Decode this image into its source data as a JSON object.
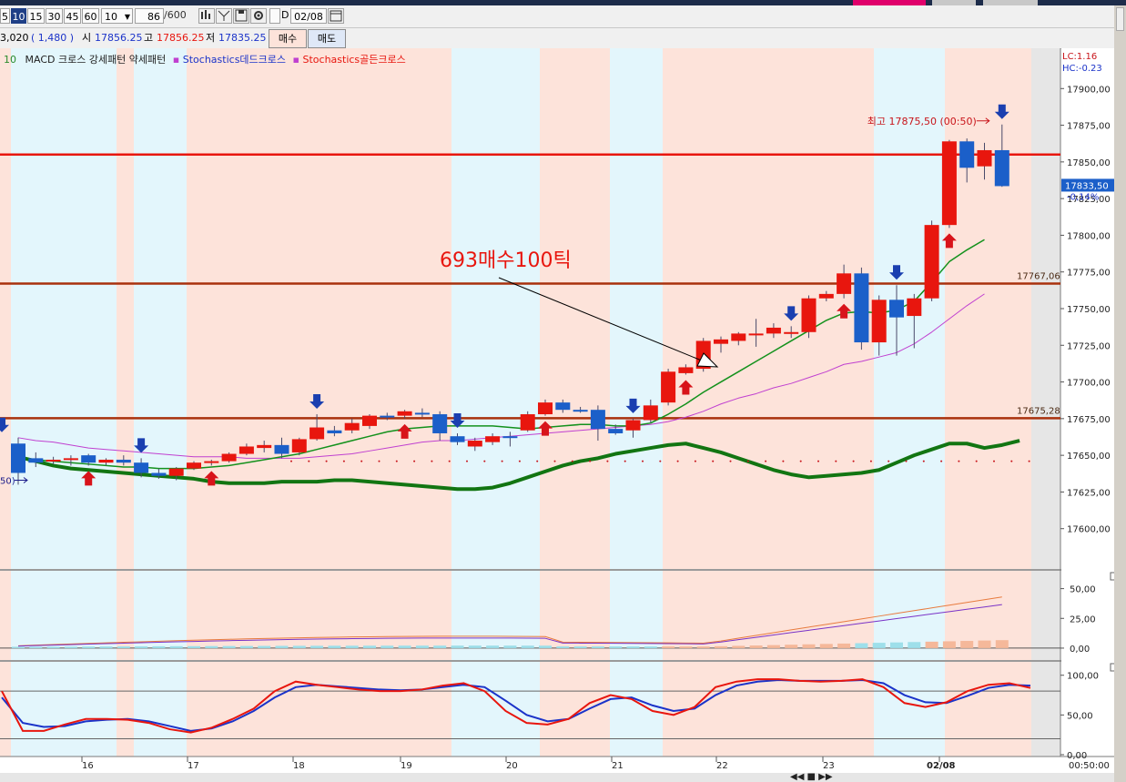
{
  "toolbar": {
    "periods": [
      "5",
      "10",
      "15",
      "30",
      "45",
      "60"
    ],
    "selected_period": "10",
    "count_select": "10",
    "bar_count": "86",
    "bar_total": "/600",
    "date": "02/08",
    "icons": [
      "chart-settings-icon",
      "crosshair-icon",
      "save-icon",
      "gear-icon"
    ]
  },
  "quote": {
    "price_part": "3,020",
    "change": "( 1,480 )",
    "open_label": "시",
    "open": "17856.25",
    "high_label": "고",
    "high": "17856.25",
    "low_label": "저",
    "low": "17835.25",
    "buy_button": "매수",
    "sell_button": "매도"
  },
  "legend": {
    "num": "10",
    "macd": "MACD 크로스 강세패턴  약세패턴",
    "stoch_dead": "Stochastics데드크로스",
    "stoch_gold": "Stochastics골든크로스"
  },
  "corner": {
    "lc": "LC:1.16",
    "hc": "HC:-0.23"
  },
  "annotation": {
    "text": "693매수100틱"
  },
  "colors": {
    "up": "#e8160e",
    "down": "#1b5fc9",
    "bg_pink": "#fde3da",
    "bg_cyan": "#e3f6fc",
    "ma_green": "#13911c",
    "ma_purple": "#c040d0",
    "ma_thick": "#127512",
    "red_level": "#e8160e",
    "brown_level": "#a9310d",
    "macd_orange": "#e87b3e",
    "macd_purple": "#7a33c7",
    "stoch_red": "#e8160e",
    "stoch_blue": "#1b33c9"
  },
  "chart_data": [
    {
      "type": "candlestick",
      "x_dates": [
        "16",
        "17",
        "18",
        "19",
        "20",
        "21",
        "22",
        "23",
        "02/08"
      ],
      "ylim": [
        17575,
        17925
      ],
      "y_ticks": [
        "17900,00",
        "17875,00",
        "17850,00",
        "17825,00",
        "17800,00",
        "17775,00",
        "17750,00",
        "17725,00",
        "17700,00",
        "17675,00",
        "17650,00",
        "17625,00",
        "17600,00"
      ],
      "y_tick_values": [
        17900,
        17875,
        17850,
        17825,
        17800,
        17775,
        17750,
        17725,
        17700,
        17675,
        17650,
        17625,
        17600
      ],
      "levels": [
        {
          "value": 17855,
          "color": "red"
        },
        {
          "value": 17767.06,
          "label": "17767,06",
          "color": "brown"
        },
        {
          "value": 17675.28,
          "label": "17675,28",
          "color": "brown"
        }
      ],
      "high_note": "최고 17875,50 (00:50)",
      "high_value": 17875.5,
      "last_price": "17833,50",
      "last_change": "-0,14%",
      "left_note": "50)",
      "candles": [
        {
          "o": 17658,
          "h": 17662,
          "l": 17630,
          "c": 17638
        },
        {
          "o": 17648,
          "h": 17652,
          "l": 17642,
          "c": 17645
        },
        {
          "o": 17646,
          "h": 17649,
          "l": 17644,
          "c": 17647
        },
        {
          "o": 17647,
          "h": 17650,
          "l": 17643,
          "c": 17648
        },
        {
          "o": 17650,
          "h": 17651,
          "l": 17643,
          "c": 17645
        },
        {
          "o": 17645,
          "h": 17648,
          "l": 17643,
          "c": 17647
        },
        {
          "o": 17647,
          "h": 17650,
          "l": 17643,
          "c": 17645
        },
        {
          "o": 17645,
          "h": 17648,
          "l": 17635,
          "c": 17638
        },
        {
          "o": 17638,
          "h": 17641,
          "l": 17634,
          "c": 17636
        },
        {
          "o": 17636,
          "h": 17642,
          "l": 17633,
          "c": 17641
        },
        {
          "o": 17641,
          "h": 17646,
          "l": 17640,
          "c": 17645
        },
        {
          "o": 17645,
          "h": 17647,
          "l": 17643,
          "c": 17646
        },
        {
          "o": 17646,
          "h": 17652,
          "l": 17645,
          "c": 17651
        },
        {
          "o": 17651,
          "h": 17658,
          "l": 17650,
          "c": 17656
        },
        {
          "o": 17655,
          "h": 17660,
          "l": 17652,
          "c": 17657
        },
        {
          "o": 17657,
          "h": 17662,
          "l": 17648,
          "c": 17651
        },
        {
          "o": 17652,
          "h": 17662,
          "l": 17650,
          "c": 17661
        },
        {
          "o": 17661,
          "h": 17678,
          "l": 17660,
          "c": 17669
        },
        {
          "o": 17667,
          "h": 17670,
          "l": 17663,
          "c": 17665
        },
        {
          "o": 17667,
          "h": 17675,
          "l": 17665,
          "c": 17672
        },
        {
          "o": 17670,
          "h": 17678,
          "l": 17668,
          "c": 17677
        },
        {
          "o": 17677,
          "h": 17679,
          "l": 17674,
          "c": 17676
        },
        {
          "o": 17677,
          "h": 17681,
          "l": 17675,
          "c": 17680
        },
        {
          "o": 17679,
          "h": 17682,
          "l": 17676,
          "c": 17678
        },
        {
          "o": 17678,
          "h": 17680,
          "l": 17660,
          "c": 17665
        },
        {
          "o": 17663,
          "h": 17665,
          "l": 17657,
          "c": 17659
        },
        {
          "o": 17656,
          "h": 17662,
          "l": 17653,
          "c": 17660
        },
        {
          "o": 17659,
          "h": 17665,
          "l": 17657,
          "c": 17663
        },
        {
          "o": 17663,
          "h": 17666,
          "l": 17656,
          "c": 17662
        },
        {
          "o": 17667,
          "h": 17680,
          "l": 17666,
          "c": 17678
        },
        {
          "o": 17678,
          "h": 17688,
          "l": 17677,
          "c": 17686
        },
        {
          "o": 17686,
          "h": 17688,
          "l": 17679,
          "c": 17681
        },
        {
          "o": 17681,
          "h": 17683,
          "l": 17679,
          "c": 17680
        },
        {
          "o": 17681,
          "h": 17684,
          "l": 17660,
          "c": 17668
        },
        {
          "o": 17668,
          "h": 17671,
          "l": 17664,
          "c": 17665
        },
        {
          "o": 17667,
          "h": 17675,
          "l": 17662,
          "c": 17674
        },
        {
          "o": 17674,
          "h": 17688,
          "l": 17672,
          "c": 17684
        },
        {
          "o": 17686,
          "h": 17709,
          "l": 17684,
          "c": 17707
        },
        {
          "o": 17706,
          "h": 17712,
          "l": 17705,
          "c": 17710
        },
        {
          "o": 17709,
          "h": 17730,
          "l": 17707,
          "c": 17728
        },
        {
          "o": 17726,
          "h": 17731,
          "l": 17720,
          "c": 17729
        },
        {
          "o": 17728,
          "h": 17734,
          "l": 17725,
          "c": 17733
        },
        {
          "o": 17733,
          "h": 17743,
          "l": 17724,
          "c": 17733
        },
        {
          "o": 17733,
          "h": 17740,
          "l": 17730,
          "c": 17737
        },
        {
          "o": 17733,
          "h": 17738,
          "l": 17730,
          "c": 17734
        },
        {
          "o": 17734,
          "h": 17759,
          "l": 17730,
          "c": 17757
        },
        {
          "o": 17757,
          "h": 17762,
          "l": 17755,
          "c": 17760
        },
        {
          "o": 17760,
          "h": 17780,
          "l": 17757,
          "c": 17774
        },
        {
          "o": 17774,
          "h": 17778,
          "l": 17722,
          "c": 17727
        },
        {
          "o": 17727,
          "h": 17759,
          "l": 17718,
          "c": 17756
        },
        {
          "o": 17756,
          "h": 17766,
          "l": 17718,
          "c": 17744
        },
        {
          "o": 17745,
          "h": 17760,
          "l": 17723,
          "c": 17757
        },
        {
          "o": 17757,
          "h": 17810,
          "l": 17755,
          "c": 17807
        },
        {
          "o": 17807,
          "h": 17865,
          "l": 17805,
          "c": 17864
        },
        {
          "o": 17864,
          "h": 17866,
          "l": 17836,
          "c": 17846
        },
        {
          "o": 17847,
          "h": 17863,
          "l": 17838,
          "c": 17858
        },
        {
          "o": 17858,
          "h": 17875.5,
          "l": 17833,
          "c": 17833.5
        }
      ],
      "ma_green": [
        17648,
        17647,
        17646,
        17645,
        17644,
        17643,
        17642,
        17642,
        17641,
        17641,
        17641,
        17642,
        17643,
        17645,
        17647,
        17649,
        17651,
        17654,
        17657,
        17660,
        17663,
        17666,
        17668,
        17669,
        17670,
        17670,
        17670,
        17670,
        17669,
        17668,
        17669,
        17670,
        17671,
        17671,
        17670,
        17670,
        17672,
        17678,
        17685,
        17693,
        17700,
        17707,
        17714,
        17721,
        17728,
        17735,
        17742,
        17747,
        17748,
        17747,
        17749,
        17755,
        17768,
        17782,
        17790,
        17797
      ],
      "ma_purple": [
        17662,
        17660,
        17659,
        17657,
        17655,
        17654,
        17653,
        17652,
        17651,
        17650,
        17649,
        17649,
        17649,
        17648,
        17648,
        17648,
        17648,
        17649,
        17650,
        17651,
        17653,
        17655,
        17657,
        17659,
        17660,
        17660,
        17661,
        17662,
        17663,
        17664,
        17665,
        17666,
        17667,
        17668,
        17669,
        17670,
        17671,
        17673,
        17676,
        17680,
        17685,
        17689,
        17692,
        17696,
        17699,
        17703,
        17707,
        17712,
        17714,
        17717,
        17720,
        17726,
        17734,
        17743,
        17752,
        17760
      ],
      "ma_thick": [
        17649,
        17646,
        17643,
        17641,
        17640,
        17639,
        17638,
        17637,
        17636,
        17635,
        17634,
        17632,
        17631,
        17631,
        17631,
        17632,
        17632,
        17632,
        17633,
        17633,
        17632,
        17631,
        17630,
        17629,
        17628,
        17627,
        17627,
        17628,
        17631,
        17635,
        17639,
        17643,
        17646,
        17648,
        17651,
        17653,
        17655,
        17657,
        17658,
        17655,
        17652,
        17648,
        17644,
        17640,
        17637,
        17635,
        17636,
        17637,
        17638,
        17640,
        17645,
        17650,
        17654,
        17658,
        17658,
        17655,
        17657,
        17660
      ]
    },
    {
      "type": "line",
      "name_panel": "macd",
      "ylim": [
        -10,
        65
      ],
      "y_ticks": [
        "50,00",
        "25,00",
        "0,00"
      ],
      "y_tick_values": [
        50,
        25,
        0
      ]
    },
    {
      "type": "line",
      "name_panel": "stochastics",
      "ylim": [
        0,
        110
      ],
      "y_ticks": [
        "100,00",
        "50,00",
        "0,00"
      ],
      "y_tick_values": [
        100,
        50,
        0
      ],
      "stoch_k": [
        80,
        30,
        30,
        38,
        45,
        45,
        44,
        40,
        32,
        28,
        34,
        45,
        58,
        80,
        92,
        88,
        85,
        82,
        80,
        80,
        82,
        87,
        90,
        80,
        55,
        40,
        38,
        45,
        65,
        75,
        70,
        55,
        50,
        60,
        85,
        92,
        95,
        95,
        93,
        92,
        93,
        95,
        85,
        65,
        60,
        66,
        80,
        88,
        90,
        84
      ],
      "stoch_d": [
        72,
        40,
        35,
        36,
        42,
        44,
        45,
        42,
        36,
        30,
        33,
        42,
        55,
        72,
        85,
        88,
        86,
        84,
        82,
        81,
        82,
        85,
        88,
        85,
        68,
        50,
        42,
        45,
        58,
        70,
        72,
        62,
        55,
        58,
        75,
        87,
        92,
        94,
        93,
        93,
        93,
        94,
        90,
        75,
        66,
        65,
        74,
        84,
        88,
        87
      ]
    }
  ],
  "x_end_time": "00:50:00",
  "bottom_nav": "◀◀ ■ ▶▶"
}
